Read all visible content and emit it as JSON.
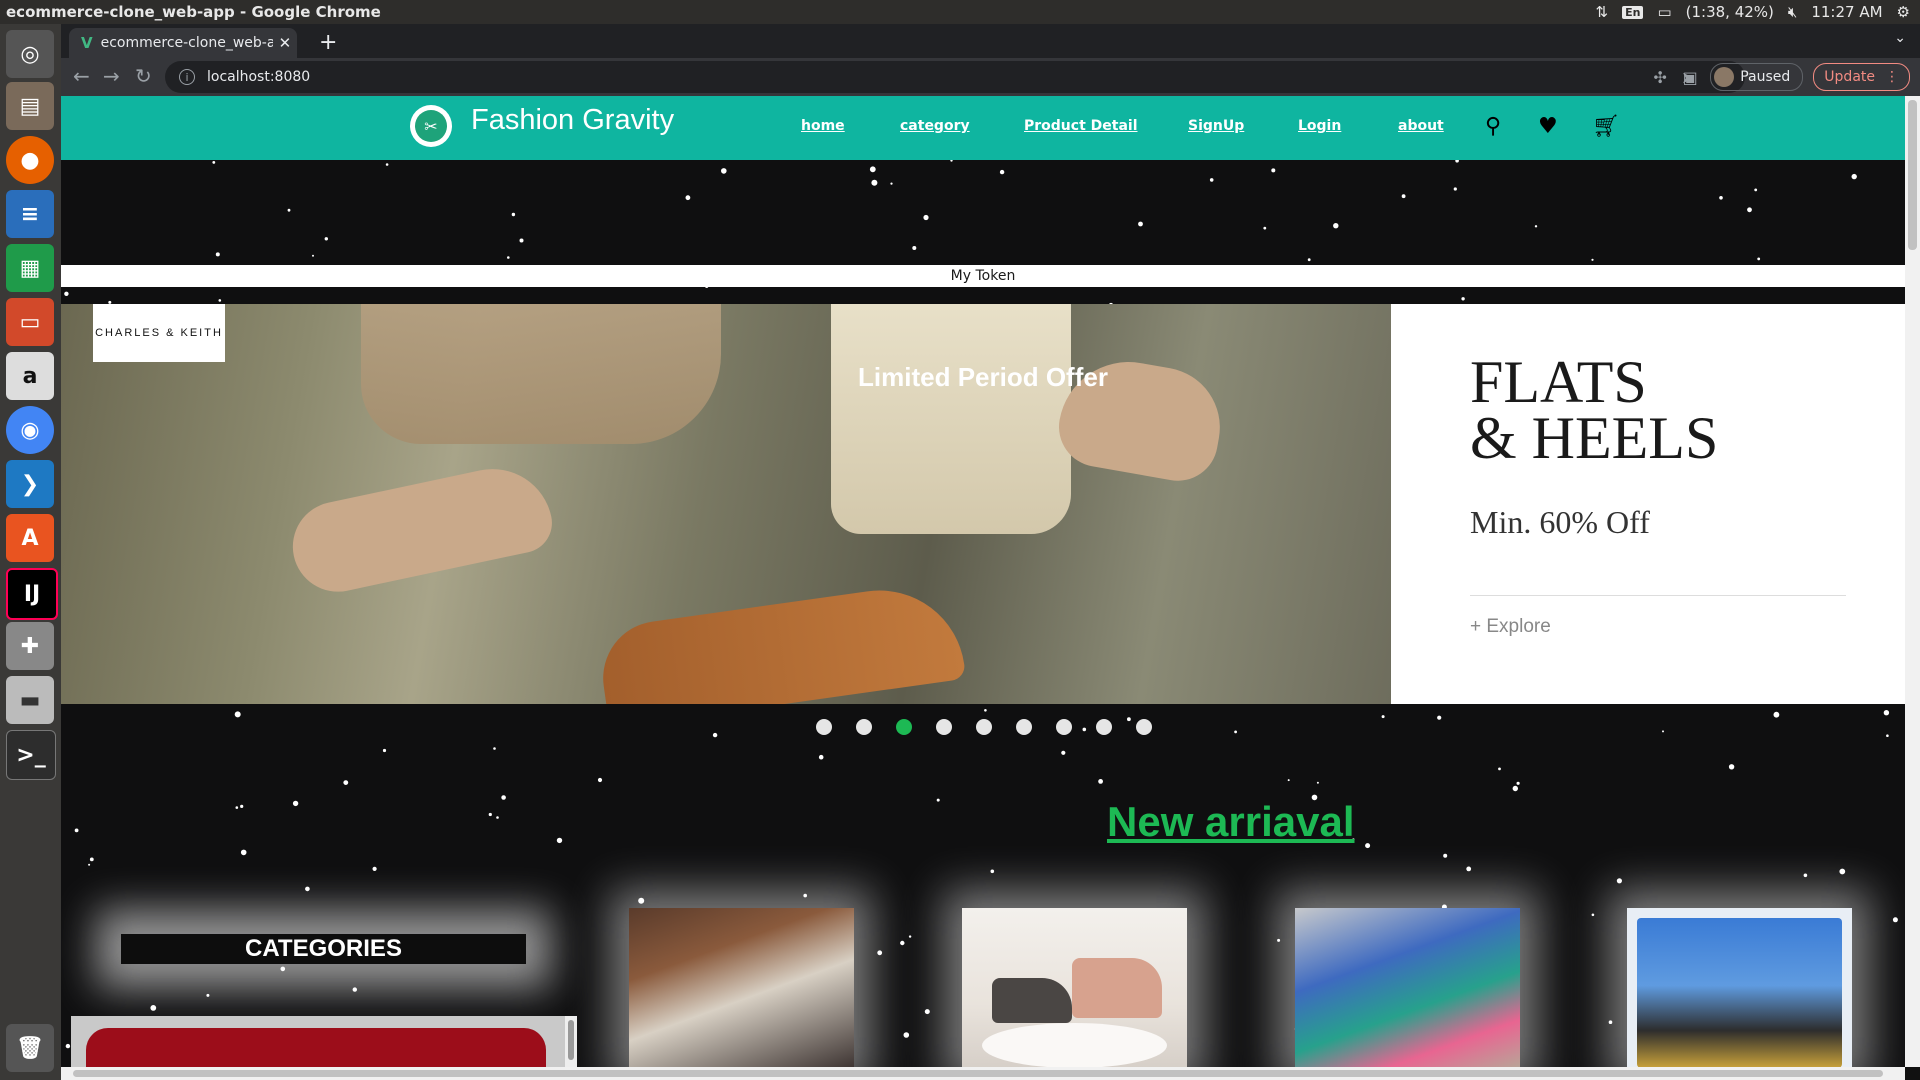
{
  "os": {
    "window_title": "ecommerce-clone_web-app - Google Chrome",
    "language": "En",
    "battery": "(1:38, 42%)",
    "clock": "11:27 AM"
  },
  "browser": {
    "tab_title": "ecommerce-clone_web-app",
    "url": "localhost:8080",
    "profile_status": "Paused",
    "update_label": "Update"
  },
  "site": {
    "brand": "Fashion Gravity",
    "nav": [
      "home",
      "category",
      "Product Detail",
      "SignUp",
      "Login",
      "about"
    ],
    "token_label": "My Token",
    "banner": {
      "brand_box": "CHARLES & KEITH",
      "offer": "Limited Period Offer",
      "headline_line1": "FLATS",
      "headline_line2": "& HEELS",
      "discount": "Min. 60% Off",
      "cta": "+ Explore"
    },
    "carousel": {
      "total": 9,
      "active_index": 2
    },
    "section_title": "New arriaval",
    "categories_title": "CATEGORIES"
  },
  "colors": {
    "header_bg": "#0fb5a0",
    "accent_green": "#1db954",
    "category_red": "#9c0d1a"
  }
}
